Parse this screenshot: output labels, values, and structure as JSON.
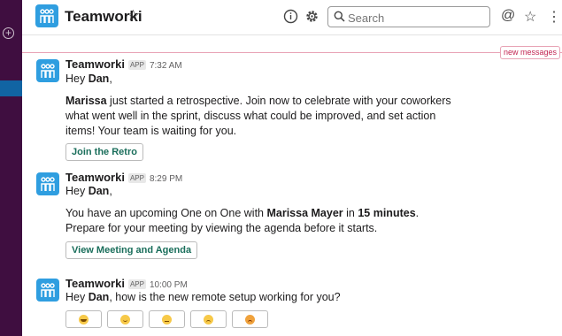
{
  "workspace": {
    "name": "Teamworki"
  },
  "search": {
    "placeholder": "Search"
  },
  "divider": {
    "label": "new messages"
  },
  "messages": [
    {
      "sender": "Teamworki",
      "badge": "APP",
      "time": "7:32 AM",
      "greeting_pre": "Hey ",
      "greeting_name": "Dan",
      "greeting_post": ",",
      "line_bold": "Marissa",
      "line_rest": " just started a retrospective. Join now to celebrate with your coworkers what went well in the sprint, discuss what could be improved, and set action items! Your team is waiting for you.",
      "button": "Join the Retro"
    },
    {
      "sender": "Teamworki",
      "badge": "APP",
      "time": "8:29 PM",
      "greeting_pre": "Hey ",
      "greeting_name": "Dan",
      "greeting_post": ",",
      "line_a": "You have an upcoming One on One with ",
      "line_b": "Marissa Mayer",
      "line_c": " in ",
      "line_d": "15 minutes",
      "line_e": ". Prepare for your meeting by viewing the agenda before it starts.",
      "button": "View Meeting and Agenda"
    },
    {
      "sender": "Teamworki",
      "badge": "APP",
      "time": "10:00 PM",
      "greeting_pre": "Hey ",
      "greeting_name": "Dan",
      "greeting_post": ", how is the new remote setup working for you?",
      "reactions": [
        "grinning-face",
        "slightly-smiling-face",
        "neutral-face",
        "slightly-frowning-face",
        "angry-face"
      ]
    }
  ],
  "colors": {
    "sidebar": "#3f0e40",
    "active": "#1164a3",
    "accent": "#2f9ee0",
    "new_messages": "#c22552",
    "button_text": "#1a6e5b"
  }
}
